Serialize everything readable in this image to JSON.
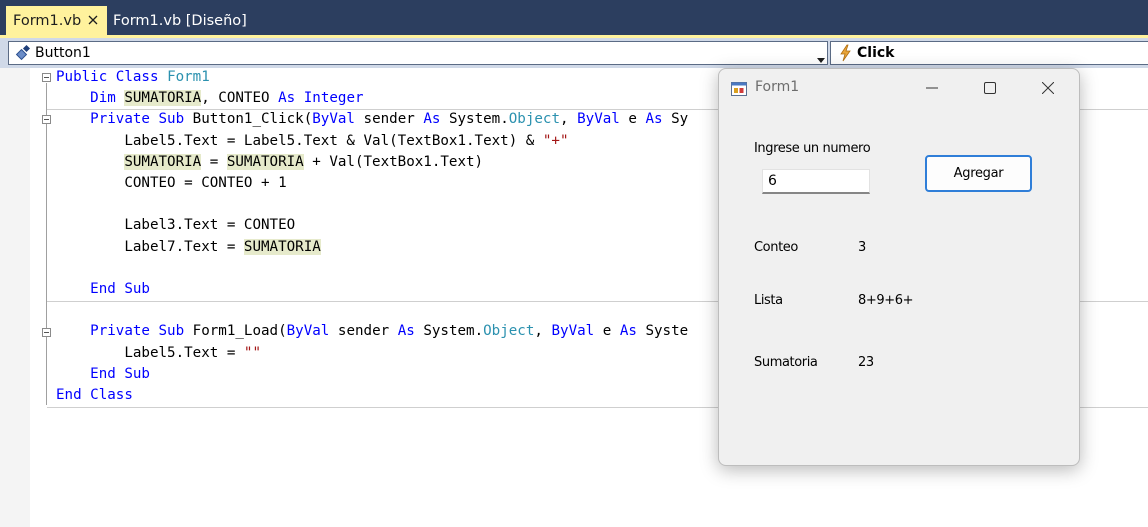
{
  "tabs": [
    {
      "label": "Form1.vb",
      "active": true
    },
    {
      "label": "Form1.vb [Diseño]",
      "active": false
    }
  ],
  "navbar": {
    "object_selector": "Button1",
    "event_selector": "Click"
  },
  "code": {
    "lines": [
      {
        "tokens": [
          {
            "t": "Public",
            "c": "kw"
          },
          {
            "t": " "
          },
          {
            "t": "Class",
            "c": "kw"
          },
          {
            "t": " "
          },
          {
            "t": "Form1",
            "c": "ty"
          }
        ]
      },
      {
        "tokens": [
          {
            "t": "    "
          },
          {
            "t": "Dim",
            "c": "kw"
          },
          {
            "t": " "
          },
          {
            "t": "SUMATORIA",
            "c": "hl"
          },
          {
            "t": ", CONTEO "
          },
          {
            "t": "As",
            "c": "kw"
          },
          {
            "t": " "
          },
          {
            "t": "Integer",
            "c": "kw"
          }
        ]
      },
      {
        "tokens": [
          {
            "t": "    "
          },
          {
            "t": "Private",
            "c": "kw"
          },
          {
            "t": " "
          },
          {
            "t": "Sub",
            "c": "kw"
          },
          {
            "t": " Button1_Click("
          },
          {
            "t": "ByVal",
            "c": "kw"
          },
          {
            "t": " sender "
          },
          {
            "t": "As",
            "c": "kw"
          },
          {
            "t": " System."
          },
          {
            "t": "Object",
            "c": "ty"
          },
          {
            "t": ", "
          },
          {
            "t": "ByVal",
            "c": "kw"
          },
          {
            "t": " e "
          },
          {
            "t": "As",
            "c": "kw"
          },
          {
            "t": " Sy"
          }
        ]
      },
      {
        "tokens": [
          {
            "t": "        Label5.Text = Label5.Text & Val(TextBox1.Text) & "
          },
          {
            "t": "\"+\"",
            "c": "st"
          }
        ]
      },
      {
        "tokens": [
          {
            "t": "        "
          },
          {
            "t": "SUMATORIA",
            "c": "hl"
          },
          {
            "t": " = "
          },
          {
            "t": "SUMATORIA",
            "c": "hl"
          },
          {
            "t": " + Val(TextBox1.Text)"
          }
        ]
      },
      {
        "tokens": [
          {
            "t": "        CONTEO = CONTEO + 1"
          }
        ]
      },
      {
        "tokens": []
      },
      {
        "tokens": [
          {
            "t": "        Label3.Text = CONTEO"
          }
        ]
      },
      {
        "tokens": [
          {
            "t": "        Label7.Text = "
          },
          {
            "t": "SUMATORIA",
            "c": "hl"
          }
        ]
      },
      {
        "tokens": []
      },
      {
        "tokens": [
          {
            "t": "    "
          },
          {
            "t": "End",
            "c": "kw"
          },
          {
            "t": " "
          },
          {
            "t": "Sub",
            "c": "kw"
          }
        ]
      },
      {
        "tokens": []
      },
      {
        "tokens": [
          {
            "t": "    "
          },
          {
            "t": "Private",
            "c": "kw"
          },
          {
            "t": " "
          },
          {
            "t": "Sub",
            "c": "kw"
          },
          {
            "t": " Form1_Load("
          },
          {
            "t": "ByVal",
            "c": "kw"
          },
          {
            "t": " sender "
          },
          {
            "t": "As",
            "c": "kw"
          },
          {
            "t": " System."
          },
          {
            "t": "Object",
            "c": "ty"
          },
          {
            "t": ", "
          },
          {
            "t": "ByVal",
            "c": "kw"
          },
          {
            "t": " e "
          },
          {
            "t": "As",
            "c": "kw"
          },
          {
            "t": " Syste"
          }
        ]
      },
      {
        "tokens": [
          {
            "t": "        Label5.Text = "
          },
          {
            "t": "\"\"",
            "c": "st"
          }
        ]
      },
      {
        "tokens": [
          {
            "t": "    "
          },
          {
            "t": "End",
            "c": "kw"
          },
          {
            "t": " "
          },
          {
            "t": "Sub",
            "c": "kw"
          }
        ]
      },
      {
        "tokens": [
          {
            "t": "End",
            "c": "kw"
          },
          {
            "t": " "
          },
          {
            "t": "Class",
            "c": "kw"
          }
        ]
      }
    ]
  },
  "form": {
    "title": "Form1",
    "input_label": "Ingrese un numero",
    "input_value": "6",
    "add_button": "Agregar",
    "conteo_label": "Conteo",
    "conteo_value": "3",
    "lista_label": "Lista",
    "lista_value": "8+9+6+",
    "sumatoria_label": "Sumatoria",
    "sumatoria_value": "23"
  },
  "colors": {
    "tabstrip": "#2c3e5f",
    "active_tab": "#fff29d",
    "keyword": "#0000ff",
    "type": "#2b91af",
    "string": "#a31515",
    "highlight": "#e6eacb",
    "accent_button_border": "#2f7ed8"
  }
}
